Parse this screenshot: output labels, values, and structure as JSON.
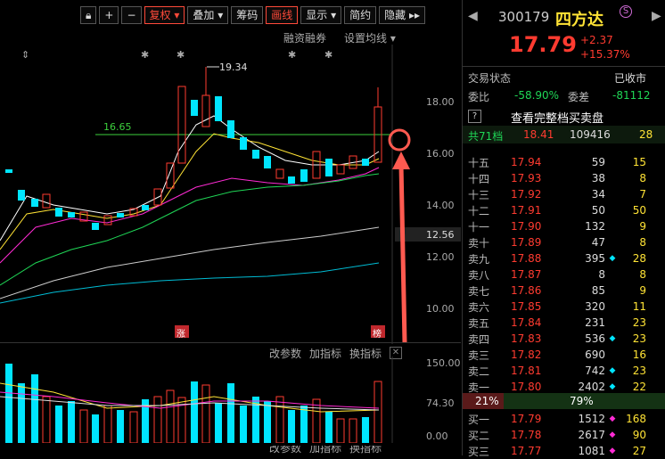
{
  "toolbar": {
    "buttons": [
      "复权",
      "叠加",
      "筹码",
      "画线",
      "显示",
      "简约",
      "隐藏"
    ],
    "sub_links": [
      "融资融券",
      "设置均线"
    ]
  },
  "chart": {
    "price_axis": [
      "18.00",
      "16.00",
      "14.00",
      "12.56",
      "12.00",
      "10.00"
    ],
    "high_label": "19.34",
    "level_label": "16.65",
    "badges": [
      "涨",
      "榜"
    ]
  },
  "indicator": {
    "links": [
      "改参数",
      "加指标",
      "换指标"
    ],
    "axis": [
      "150.00",
      "74.30",
      "0.00"
    ]
  },
  "stock": {
    "code": "300179",
    "name": "四方达",
    "price": "17.79",
    "change": "+2.37",
    "change_pct": "+15.37%"
  },
  "trade_status": {
    "label": "交易状态",
    "value": "已收市"
  },
  "ratio": {
    "wb_label": "委比",
    "wb_value": "-58.90%",
    "wc_label": "委差",
    "wc_value": "-81112"
  },
  "full_book_link": "查看完整档买卖盘",
  "total": {
    "label": "共71档",
    "price": "18.41",
    "vol": "109416",
    "count": "28"
  },
  "asks": [
    {
      "label": "十五",
      "price": "17.94",
      "vol": "59",
      "count": "15",
      "dot": ""
    },
    {
      "label": "十四",
      "price": "17.93",
      "vol": "38",
      "count": "8",
      "dot": ""
    },
    {
      "label": "十三",
      "price": "17.92",
      "vol": "34",
      "count": "7",
      "dot": ""
    },
    {
      "label": "十二",
      "price": "17.91",
      "vol": "50",
      "count": "50",
      "dot": ""
    },
    {
      "label": "十一",
      "price": "17.90",
      "vol": "132",
      "count": "9",
      "dot": ""
    },
    {
      "label": "卖十",
      "price": "17.89",
      "vol": "47",
      "count": "8",
      "dot": ""
    },
    {
      "label": "卖九",
      "price": "17.88",
      "vol": "395",
      "count": "28",
      "dot": "cyan"
    },
    {
      "label": "卖八",
      "price": "17.87",
      "vol": "8",
      "count": "8",
      "dot": ""
    },
    {
      "label": "卖七",
      "price": "17.86",
      "vol": "85",
      "count": "9",
      "dot": ""
    },
    {
      "label": "卖六",
      "price": "17.85",
      "vol": "320",
      "count": "11",
      "dot": ""
    },
    {
      "label": "卖五",
      "price": "17.84",
      "vol": "231",
      "count": "23",
      "dot": ""
    },
    {
      "label": "卖四",
      "price": "17.83",
      "vol": "536",
      "count": "23",
      "dot": "cyan"
    },
    {
      "label": "卖三",
      "price": "17.82",
      "vol": "690",
      "count": "16",
      "dot": ""
    },
    {
      "label": "卖二",
      "price": "17.81",
      "vol": "742",
      "count": "23",
      "dot": "cyan"
    },
    {
      "label": "卖一",
      "price": "17.80",
      "vol": "2402",
      "count": "22",
      "dot": "cyan"
    }
  ],
  "split": {
    "left": "21%",
    "right": "79%"
  },
  "bids": [
    {
      "label": "买一",
      "price": "17.79",
      "vol": "1512",
      "count": "168",
      "dot": "magenta"
    },
    {
      "label": "买二",
      "price": "17.78",
      "vol": "2617",
      "count": "90",
      "dot": "magenta"
    },
    {
      "label": "买三",
      "price": "17.77",
      "vol": "1081",
      "count": "27",
      "dot": "magenta"
    }
  ]
}
